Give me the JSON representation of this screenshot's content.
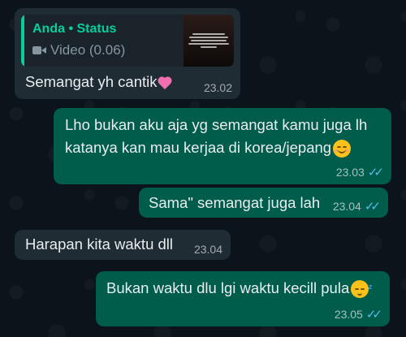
{
  "messages": [
    {
      "direction": "incoming",
      "quote": {
        "author": "Anda • Status",
        "subtitle": "Video (0.06)",
        "media_icon": "video-camera-icon"
      },
      "text": "Semangat yh cantik",
      "emoji": "sparkling-heart-icon",
      "time": "23.02"
    },
    {
      "direction": "outgoing",
      "text_line1": "Lho bukan aku aja yg semangat kamu juga lh",
      "text_line2": "katanya kan mau kerjaa di korea/jepang",
      "emoji": "smiling-face-icon",
      "time": "23.03",
      "status": "read"
    },
    {
      "direction": "outgoing",
      "text": "Sama\" semangat juga lah",
      "time": "23.04",
      "status": "read"
    },
    {
      "direction": "incoming",
      "text": "Harapan kita waktu dll",
      "time": "23.04"
    },
    {
      "direction": "outgoing",
      "text": "Bukan waktu dlu lgi waktu kecill pula",
      "emoji": "sleeping-face-icon",
      "time": "23.05",
      "status": "read"
    }
  ],
  "colors": {
    "background": "#0b141a",
    "incoming_bubble": "#202c33",
    "outgoing_bubble": "#005c4b",
    "quote_accent": "#06cf9c",
    "read_ticks": "#53bdeb"
  }
}
